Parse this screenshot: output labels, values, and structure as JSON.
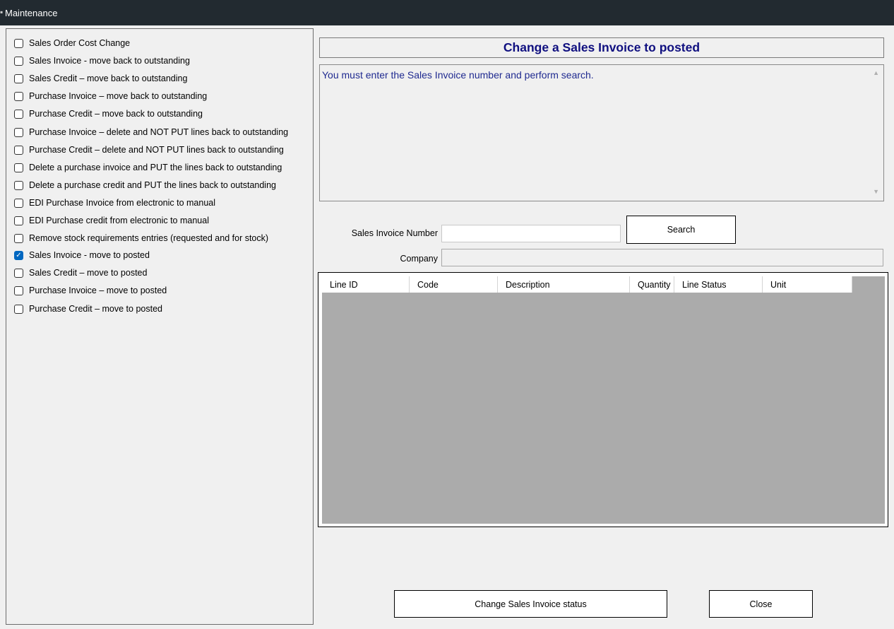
{
  "window": {
    "title": "Maintenance"
  },
  "options": [
    {
      "label": "Sales Order Cost Change",
      "checked": false
    },
    {
      "label": "Sales Invoice - move back to outstanding",
      "checked": false
    },
    {
      "label": "Sales Credit – move back to outstanding",
      "checked": false
    },
    {
      "label": "Purchase Invoice – move back to outstanding",
      "checked": false
    },
    {
      "label": "Purchase Credit – move back to outstanding",
      "checked": false
    },
    {
      "label": "Purchase Invoice – delete and NOT PUT lines back to outstanding",
      "checked": false
    },
    {
      "label": "Purchase Credit – delete and NOT PUT lines back to outstanding",
      "checked": false
    },
    {
      "label": "Delete a purchase invoice and PUT the lines back to outstanding",
      "checked": false
    },
    {
      "label": "Delete a purchase credit and PUT the lines back to outstanding",
      "checked": false
    },
    {
      "label": "EDI Purchase Invoice from electronic to manual",
      "checked": false
    },
    {
      "label": "EDI Purchase credit from electronic to manual",
      "checked": false
    },
    {
      "label": "Remove stock requirements entries (requested and for stock)",
      "checked": false
    },
    {
      "label": "Sales Invoice - move to posted",
      "checked": true
    },
    {
      "label": "Sales Credit – move to posted",
      "checked": false
    },
    {
      "label": "Purchase Invoice – move to posted",
      "checked": false
    },
    {
      "label": "Purchase Credit – move to posted",
      "checked": false
    }
  ],
  "panel": {
    "heading": "Change a Sales Invoice to posted",
    "message": "You must enter the Sales Invoice number and perform search."
  },
  "form": {
    "invoice_label": "Sales Invoice Number",
    "invoice_value": "",
    "company_label": "Company",
    "company_value": "",
    "search_label": "Search"
  },
  "grid": {
    "columns": [
      "Line ID",
      "Code",
      "Description",
      "Quantity",
      "Line Status",
      "Unit"
    ],
    "rows": []
  },
  "actions": {
    "change_label": "Change Sales Invoice status",
    "close_label": "Close"
  },
  "colors": {
    "titlebar": "#222a30",
    "heading": "#101080",
    "message": "#1f2a90",
    "grid_bg": "#ababab",
    "check": "#0067c0"
  }
}
